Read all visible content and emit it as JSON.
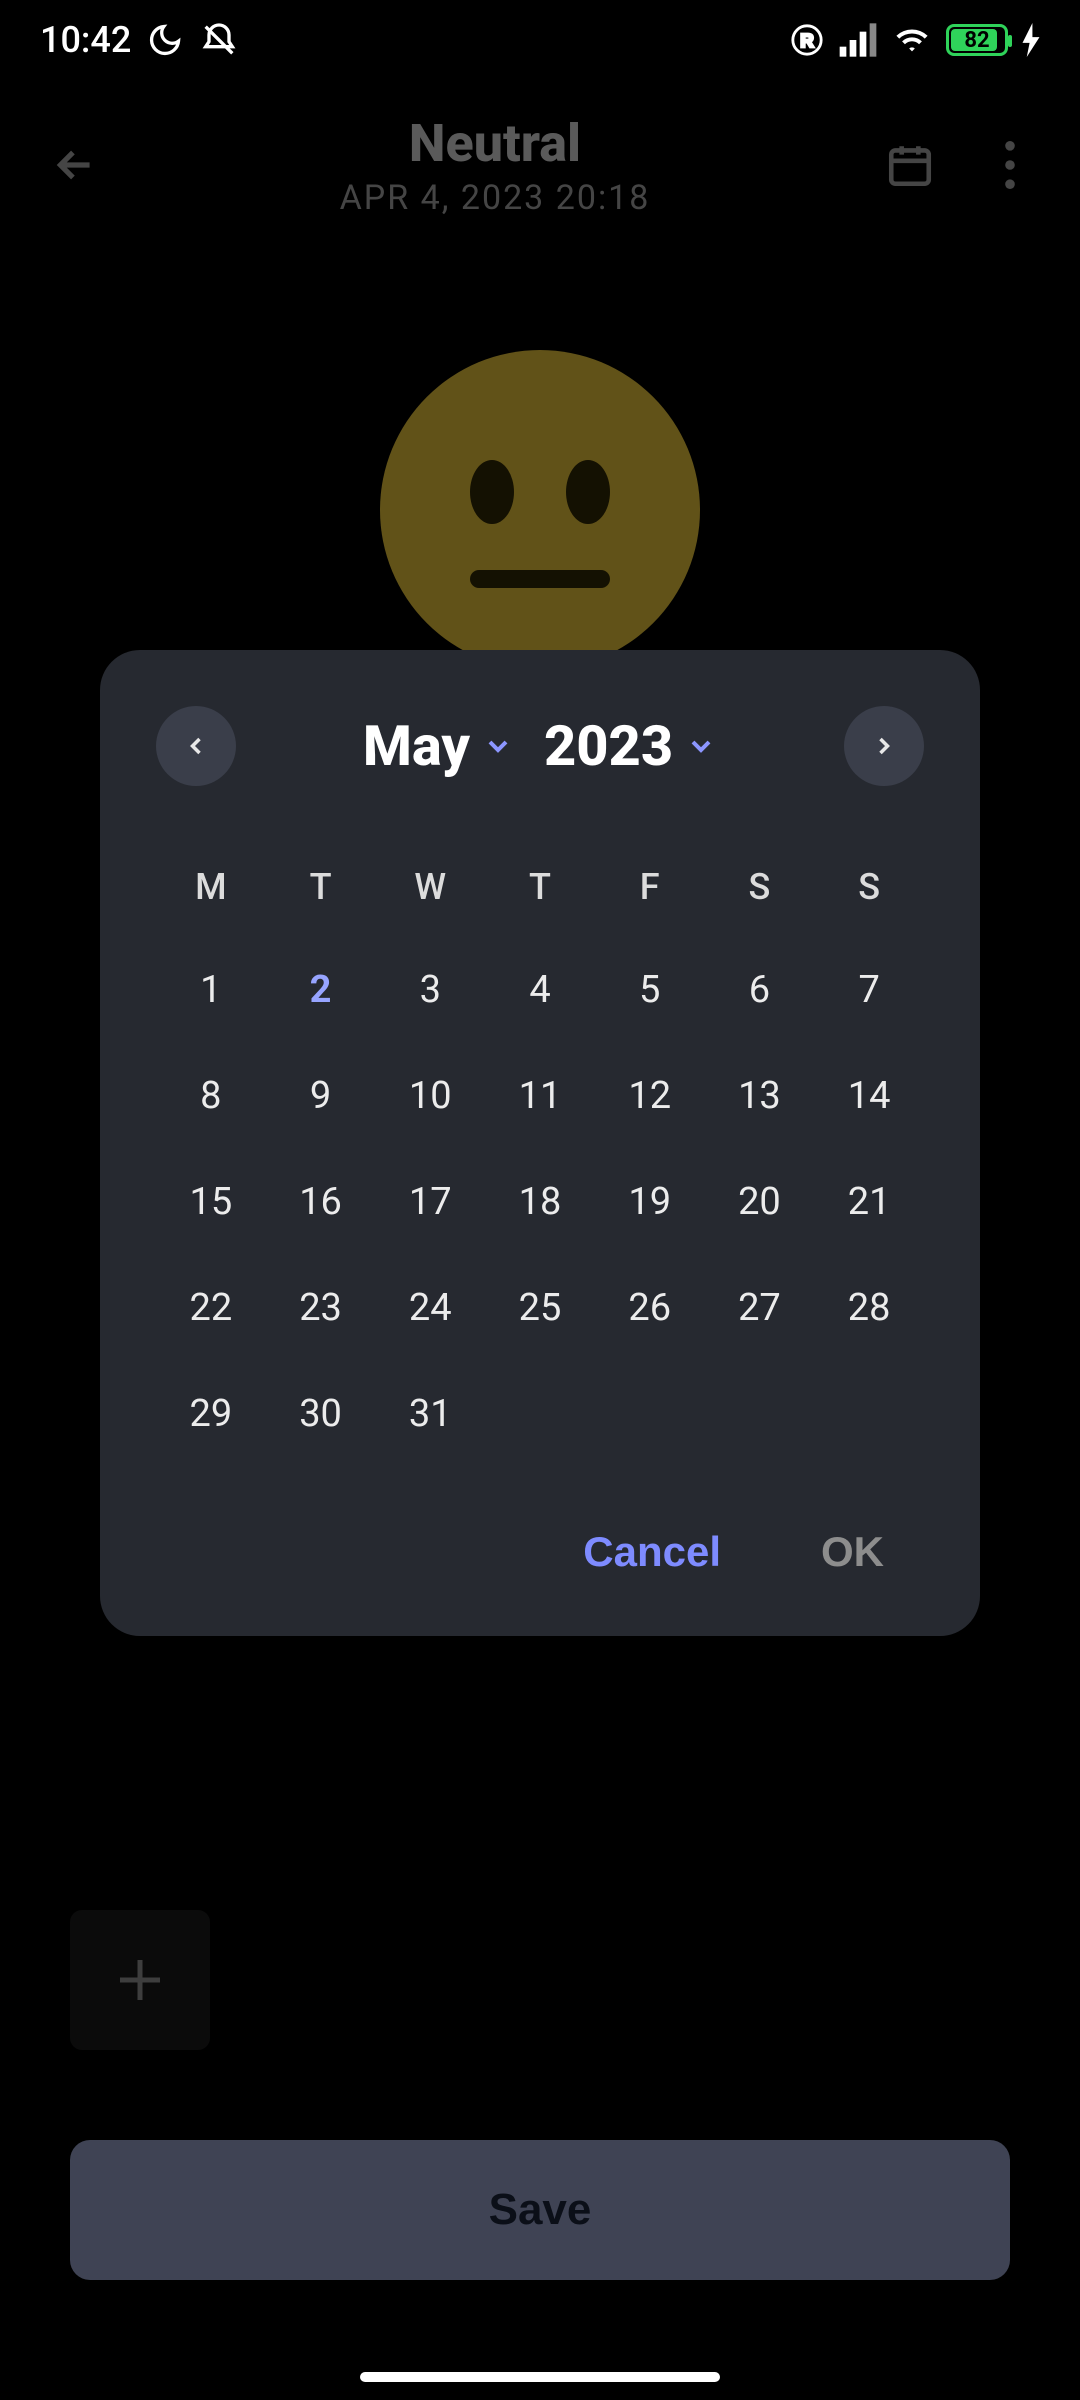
{
  "status": {
    "time": "10:42",
    "battery_pct": 82
  },
  "header": {
    "title": "Neutral",
    "subtitle": "APR 4, 2023 20:18"
  },
  "buttons": {
    "save": "Save"
  },
  "dialog": {
    "month": "May",
    "year": "2023",
    "cancel": "Cancel",
    "ok": "OK",
    "dow": [
      "M",
      "T",
      "W",
      "T",
      "F",
      "S",
      "S"
    ],
    "today": 2,
    "weeks": [
      [
        1,
        2,
        3,
        4,
        5,
        6,
        7
      ],
      [
        8,
        9,
        10,
        11,
        12,
        13,
        14
      ],
      [
        15,
        16,
        17,
        18,
        19,
        20,
        21
      ],
      [
        22,
        23,
        24,
        25,
        26,
        27,
        28
      ],
      [
        29,
        30,
        31,
        null,
        null,
        null,
        null
      ]
    ]
  }
}
